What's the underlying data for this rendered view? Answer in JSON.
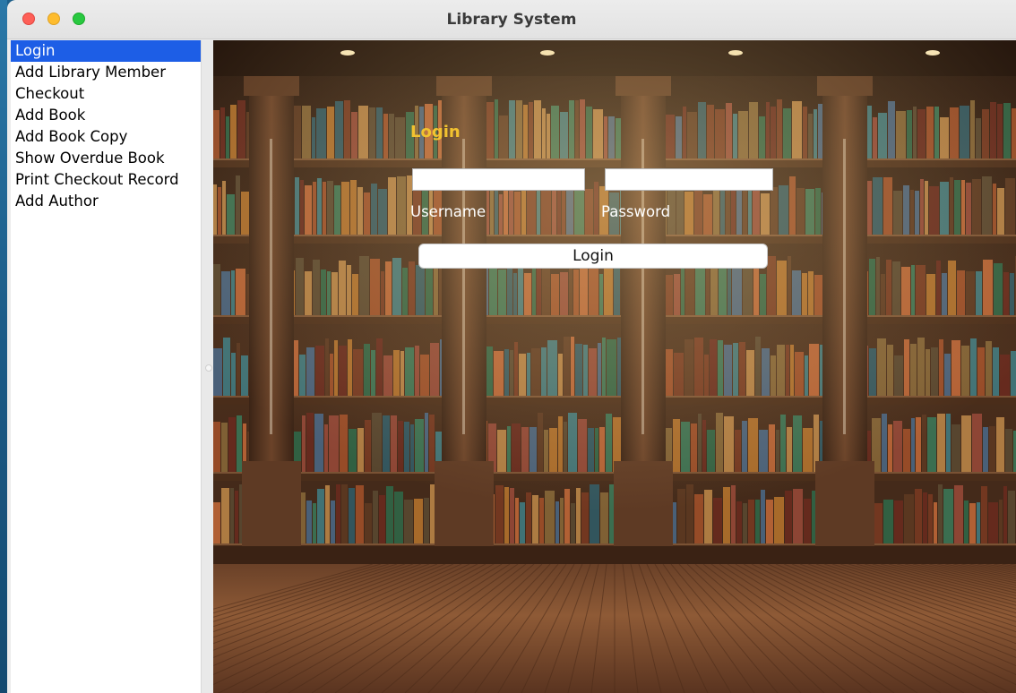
{
  "window": {
    "title": "Library System"
  },
  "sidebar": {
    "items": [
      {
        "label": "Login",
        "selected": true
      },
      {
        "label": "Add Library Member"
      },
      {
        "label": "Checkout"
      },
      {
        "label": "Add Book"
      },
      {
        "label": "Add Book Copy"
      },
      {
        "label": "Show Overdue Book"
      },
      {
        "label": "Print Checkout Record"
      },
      {
        "label": "Add Author"
      }
    ]
  },
  "login_form": {
    "heading": "Login",
    "username_label": "Username",
    "password_label": "Password",
    "username_value": "",
    "password_value": "",
    "submit_label": "Login"
  },
  "colors": {
    "selection": "#1d5ee6",
    "heading": "#f2c230",
    "traffic_close": "#fe5f57",
    "traffic_minimize": "#febc2e",
    "traffic_zoom": "#28c840"
  },
  "background": {
    "image": "library-bookshelves-wooden-floor"
  }
}
